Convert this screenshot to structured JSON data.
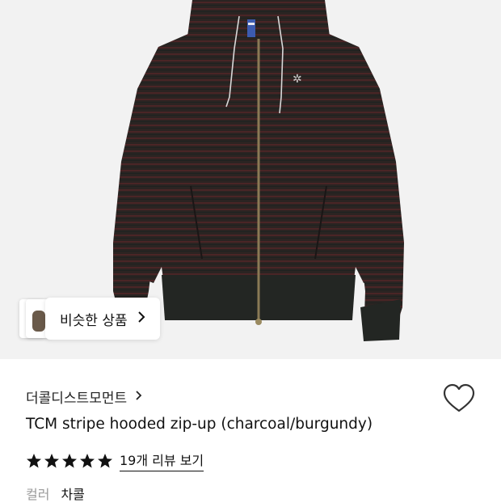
{
  "similar_products": {
    "label": "비슷한 상품",
    "chevron_icon": "chevron-right-icon"
  },
  "brand": {
    "name": "더콜디스트모먼트",
    "chevron_icon": "chevron-right-icon"
  },
  "like": {
    "icon": "heart-outline-icon"
  },
  "product": {
    "title": "TCM stripe hooded zip-up (charcoal/burgundy)",
    "rating": 5,
    "review_link": "19개 리뷰 보기"
  },
  "option": {
    "label": "컬러",
    "value": "차콜"
  },
  "colors": {
    "hero_bg": "#f2f2f2",
    "jacket": "#2b2422",
    "stripe": "#4a2526",
    "rib": "#232623"
  }
}
